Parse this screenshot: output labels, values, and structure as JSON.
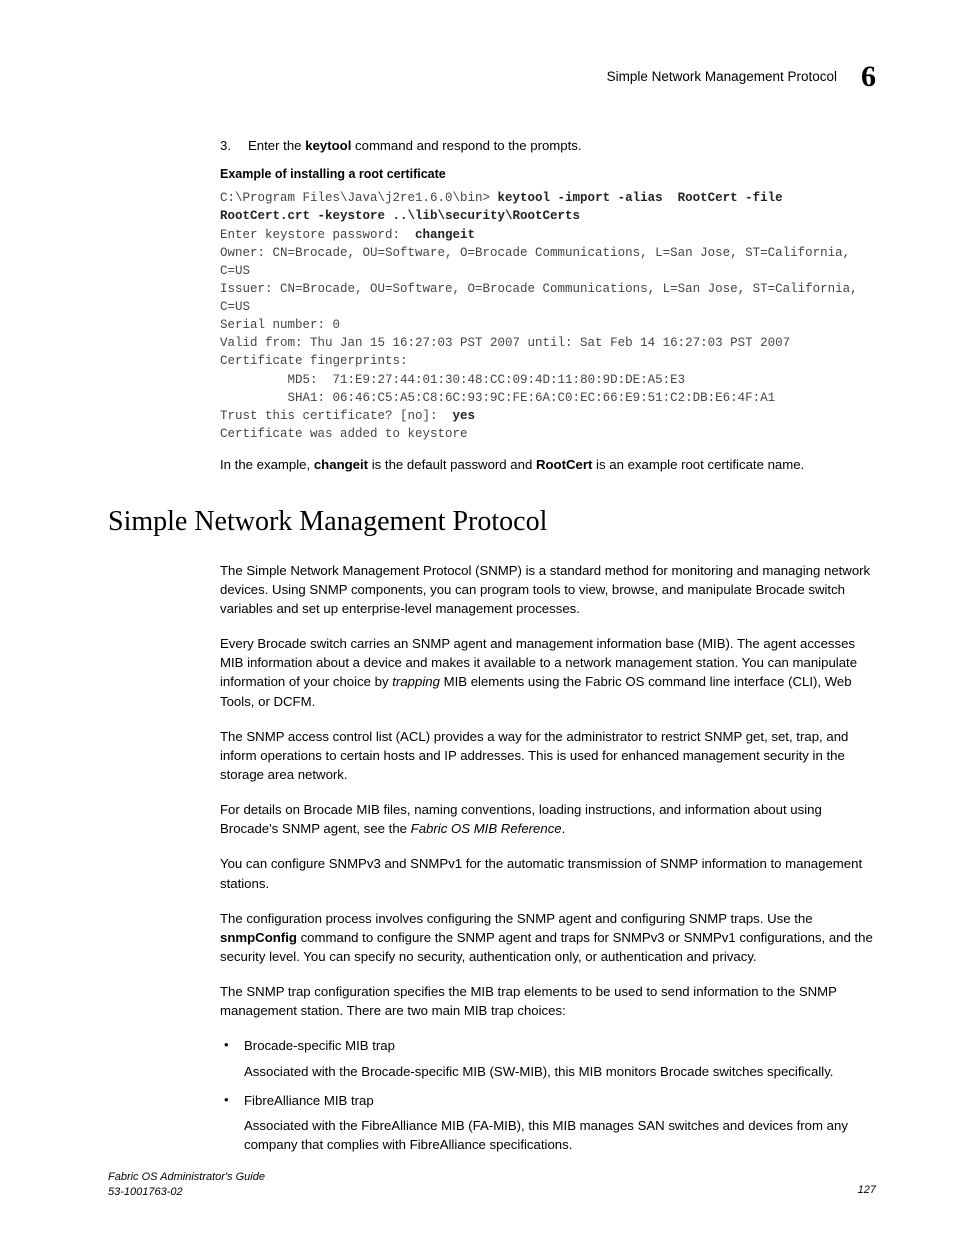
{
  "header": {
    "running_title": "Simple Network Management Protocol",
    "chapter_number": "6"
  },
  "step": {
    "number": "3.",
    "text_before": "Enter the ",
    "cmd": "keytool",
    "text_after": " command and respond to the prompts."
  },
  "example_caption": "Example of installing a root certificate",
  "code": {
    "l1a": "C:\\Program Files\\Java\\j2re1.6.0\\bin> ",
    "l1b": "keytool -import -alias  RootCert -file RootCert.crt -keystore ..\\lib\\security\\RootCerts",
    "l2a": "Enter keystore password:  ",
    "l2b": "changeit",
    "l3": "Owner: CN=Brocade, OU=Software, O=Brocade Communications, L=San Jose, ST=California, C=US",
    "l4": "Issuer: CN=Brocade, OU=Software, O=Brocade Communications, L=San Jose, ST=California, C=US",
    "l5": "Serial number: 0",
    "l6": "Valid from: Thu Jan 15 16:27:03 PST 2007 until: Sat Feb 14 16:27:03 PST 2007",
    "l7": "Certificate fingerprints:",
    "l8": "         MD5:  71:E9:27:44:01:30:48:CC:09:4D:11:80:9D:DE:A5:E3",
    "l9": "         SHA1: 06:46:C5:A5:C8:6C:93:9C:FE:6A:C0:EC:66:E9:51:C2:DB:E6:4F:A1",
    "l10a": "Trust this certificate? [no]:  ",
    "l10b": "yes",
    "l11": "Certificate was added to keystore"
  },
  "example_note": {
    "a": "In the example, ",
    "b": "changeit",
    "c": " is the default password and ",
    "d": "RootCert",
    "e": " is an example root certificate name."
  },
  "h1": "Simple Network Management Protocol",
  "p1": "The Simple Network Management Protocol (SNMP) is a standard method for monitoring and managing network devices. Using SNMP components, you can program tools to view, browse, and manipulate Brocade switch variables and set up enterprise-level management processes.",
  "p2": {
    "a": "Every Brocade switch carries an SNMP agent and management information base (MIB). The agent accesses MIB information about a device and makes it available to a network management station. You can manipulate information of your choice by ",
    "b": "trapping",
    "c": " MIB elements using the Fabric OS command line interface (CLI), Web Tools, or DCFM."
  },
  "p3": "The SNMP access control list (ACL) provides a way for the administrator to restrict SNMP get, set, trap, and inform operations to certain hosts and IP addresses. This is used for enhanced management security in the storage area network.",
  "p4": {
    "a": "For details on Brocade MIB files, naming conventions, loading instructions, and information about using Brocade's SNMP agent, see the ",
    "b": "Fabric OS MIB Reference",
    "c": "."
  },
  "p5": "You can configure SNMPv3 and SNMPv1 for the automatic transmission of SNMP information to management stations.",
  "p6": {
    "a": "The configuration process involves configuring the SNMP agent and configuring SNMP traps. Use the ",
    "b": "snmpConfig",
    "c": " command to configure the SNMP agent and traps for SNMPv3 or SNMPv1 configurations, and the security level. You can specify no security, authentication only, or authentication and privacy."
  },
  "p7": "The SNMP trap configuration specifies the MIB trap elements to be used to send information to the SNMP management station. There are two main MIB trap choices:",
  "bullets": [
    {
      "title": "Brocade-specific MIB trap",
      "body": "Associated with the Brocade-specific MIB (SW-MIB), this MIB monitors Brocade switches specifically."
    },
    {
      "title": "FibreAlliance MIB trap",
      "body": "Associated with the FibreAlliance MIB (FA-MIB), this MIB manages SAN switches and devices from any company that complies with FibreAlliance specifications."
    }
  ],
  "footer": {
    "book": "Fabric OS Administrator's Guide",
    "docnum": "53-1001763-02",
    "pagenum": "127"
  }
}
